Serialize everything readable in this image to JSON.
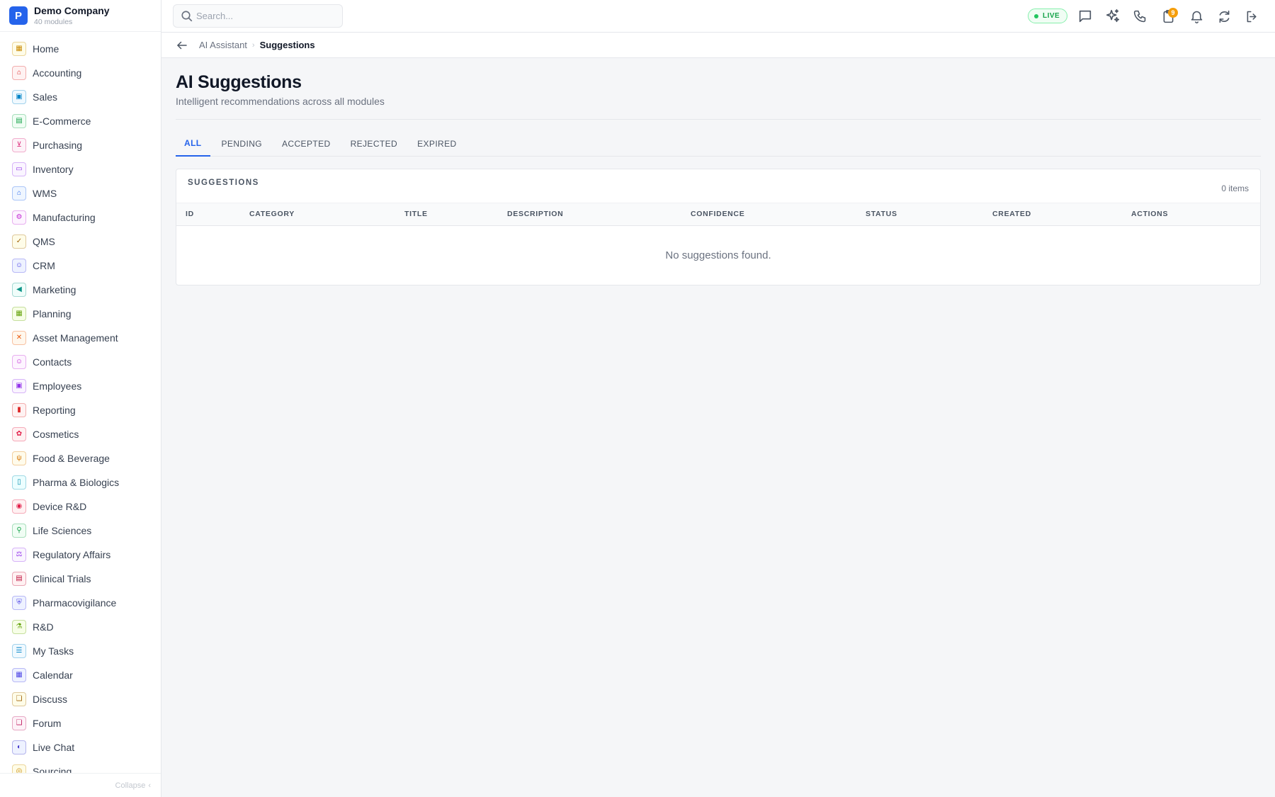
{
  "brand": {
    "logo_letter": "P",
    "name": "Demo Company",
    "subtitle": "40 modules"
  },
  "sidebar": {
    "items": [
      {
        "label": "Home",
        "icon": "grid-icon",
        "glyph": "▦",
        "color": "#ca8a04",
        "bg": "#fefce8"
      },
      {
        "label": "Accounting",
        "icon": "bank-icon",
        "glyph": "⌂",
        "color": "#dc2626",
        "bg": "#fef2f2"
      },
      {
        "label": "Sales",
        "icon": "tag-icon",
        "glyph": "▣",
        "color": "#0284c7",
        "bg": "#f0f9ff"
      },
      {
        "label": "E-Commerce",
        "icon": "store-icon",
        "glyph": "▤",
        "color": "#16a34a",
        "bg": "#f0fdf4"
      },
      {
        "label": "Purchasing",
        "icon": "cart-icon",
        "glyph": "⊻",
        "color": "#db2777",
        "bg": "#fdf2f8"
      },
      {
        "label": "Inventory",
        "icon": "box-icon",
        "glyph": "▭",
        "color": "#9333ea",
        "bg": "#faf5ff"
      },
      {
        "label": "WMS",
        "icon": "warehouse-icon",
        "glyph": "⌂",
        "color": "#2563eb",
        "bg": "#eff6ff"
      },
      {
        "label": "Manufacturing",
        "icon": "factory-icon",
        "glyph": "⚙",
        "color": "#c026d3",
        "bg": "#fdf4ff"
      },
      {
        "label": "QMS",
        "icon": "badge-check-icon",
        "glyph": "✓",
        "color": "#a16207",
        "bg": "#fefce8"
      },
      {
        "label": "CRM",
        "icon": "users-icon",
        "glyph": "☺",
        "color": "#4f46e5",
        "bg": "#eef2ff"
      },
      {
        "label": "Marketing",
        "icon": "megaphone-icon",
        "glyph": "◀",
        "color": "#0d9488",
        "bg": "#f0fdfa"
      },
      {
        "label": "Planning",
        "icon": "calendar-grid-icon",
        "glyph": "▦",
        "color": "#65a30d",
        "bg": "#f7fee7"
      },
      {
        "label": "Asset Management",
        "icon": "tools-icon",
        "glyph": "✕",
        "color": "#ea580c",
        "bg": "#fff7ed"
      },
      {
        "label": "Contacts",
        "icon": "contact-card-icon",
        "glyph": "☺",
        "color": "#c026d3",
        "bg": "#fdf4ff"
      },
      {
        "label": "Employees",
        "icon": "id-badge-icon",
        "glyph": "▣",
        "color": "#9333ea",
        "bg": "#faf5ff"
      },
      {
        "label": "Reporting",
        "icon": "bar-chart-icon",
        "glyph": "▮",
        "color": "#dc2626",
        "bg": "#fef2f2"
      },
      {
        "label": "Cosmetics",
        "icon": "flower-icon",
        "glyph": "✿",
        "color": "#e11d48",
        "bg": "#fff1f2"
      },
      {
        "label": "Food & Beverage",
        "icon": "utensils-icon",
        "glyph": "ψ",
        "color": "#d97706",
        "bg": "#fffbeb"
      },
      {
        "label": "Pharma & Biologics",
        "icon": "pill-bottle-icon",
        "glyph": "▯",
        "color": "#0891b2",
        "bg": "#ecfeff"
      },
      {
        "label": "Device R&D",
        "icon": "chip-icon",
        "glyph": "◉",
        "color": "#e11d48",
        "bg": "#fff1f2"
      },
      {
        "label": "Life Sciences",
        "icon": "microscope-icon",
        "glyph": "⚲",
        "color": "#16a34a",
        "bg": "#f0fdf4"
      },
      {
        "label": "Regulatory Affairs",
        "icon": "gavel-icon",
        "glyph": "⚖",
        "color": "#9333ea",
        "bg": "#faf5ff"
      },
      {
        "label": "Clinical Trials",
        "icon": "clipboard-icon",
        "glyph": "▤",
        "color": "#be123c",
        "bg": "#fff1f2"
      },
      {
        "label": "Pharmacovigilance",
        "icon": "shield-icon",
        "glyph": "⛨",
        "color": "#4f46e5",
        "bg": "#eef2ff"
      },
      {
        "label": "R&D",
        "icon": "flask-icon",
        "glyph": "⚗",
        "color": "#65a30d",
        "bg": "#f7fee7"
      },
      {
        "label": "My Tasks",
        "icon": "checklist-icon",
        "glyph": "☰",
        "color": "#0284c7",
        "bg": "#f0f9ff"
      },
      {
        "label": "Calendar",
        "icon": "calendar-icon",
        "glyph": "▦",
        "color": "#4f46e5",
        "bg": "#eef2ff"
      },
      {
        "label": "Discuss",
        "icon": "chat-bubbles-icon",
        "glyph": "❏",
        "color": "#a16207",
        "bg": "#fefce8"
      },
      {
        "label": "Forum",
        "icon": "forum-icon",
        "glyph": "❏",
        "color": "#be185d",
        "bg": "#fdf2f8"
      },
      {
        "label": "Live Chat",
        "icon": "headset-icon",
        "glyph": "◐",
        "color": "#4338ca",
        "bg": "#eef2ff"
      },
      {
        "label": "Sourcing",
        "icon": "sourcing-icon",
        "glyph": "◎",
        "color": "#ca8a04",
        "bg": "#fefce8"
      }
    ],
    "collapse_label": "Collapse",
    "collapse_glyph": "‹"
  },
  "topbar": {
    "search_placeholder": "Search...",
    "live_label": "LIVE",
    "notification_badge": "9"
  },
  "breadcrumb": {
    "parent": "AI Assistant",
    "separator": "›",
    "current": "Suggestions"
  },
  "page": {
    "title": "AI Suggestions",
    "subtitle": "Intelligent recommendations across all modules"
  },
  "tabs": [
    {
      "label": "ALL",
      "active": true
    },
    {
      "label": "PENDING",
      "active": false
    },
    {
      "label": "ACCEPTED",
      "active": false
    },
    {
      "label": "REJECTED",
      "active": false
    },
    {
      "label": "EXPIRED",
      "active": false
    }
  ],
  "table": {
    "title": "SUGGESTIONS",
    "count": "0 items",
    "columns": [
      "ID",
      "CATEGORY",
      "TITLE",
      "DESCRIPTION",
      "CONFIDENCE",
      "STATUS",
      "CREATED",
      "ACTIONS"
    ],
    "empty_message": "No suggestions found."
  },
  "colors": {
    "accent": "#2563eb",
    "live_green": "#16a34a",
    "badge_amber": "#f59e0b"
  }
}
